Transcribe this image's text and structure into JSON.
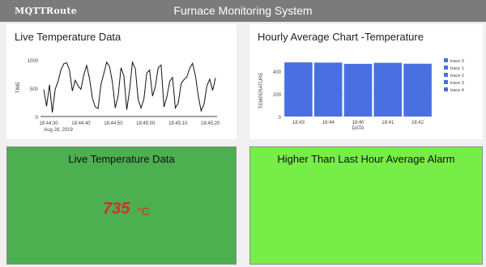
{
  "header": {
    "brand": "MQTTRoute",
    "title": "Furnace Monitoring System"
  },
  "live_chart": {
    "title": "Live Temperature Data",
    "chart_data": {
      "type": "line",
      "title": "",
      "xlabel": "",
      "ylabel": "TIME",
      "ylim": [
        0,
        1000
      ],
      "yticks": [
        "0",
        "500",
        "1000"
      ],
      "xticks": [
        "18:44:30",
        "18:44:40",
        "18:44:50",
        "18:45:00",
        "18:45:10",
        "18:45:20"
      ],
      "date_label": "Aug 28, 2019",
      "series": [
        {
          "color": "#111111",
          "values": [
            480,
            180,
            560,
            70,
            480,
            620,
            820,
            930,
            950,
            820,
            450,
            640,
            540,
            480,
            740,
            900,
            670,
            320,
            170,
            140,
            570,
            760,
            960,
            880,
            600,
            150,
            370,
            860,
            720,
            120,
            470,
            960,
            840,
            300,
            150,
            310,
            770,
            820,
            360,
            530,
            860,
            910,
            170,
            340,
            620,
            690,
            150,
            240,
            580,
            650,
            700,
            850,
            940,
            720,
            360,
            100,
            220,
            540,
            660,
            460,
            680
          ]
        }
      ]
    }
  },
  "hourly_chart": {
    "title": "Hourly Average Chart -Temperature",
    "chart_data": {
      "type": "bar",
      "title": "",
      "xlabel": "DATA",
      "ylabel": "TEMPERATURE",
      "ylim": [
        0,
        500
      ],
      "yticks": [
        "0",
        "200",
        "400"
      ],
      "categories": [
        "18:43",
        "18:44",
        "18:40",
        "18:41",
        "18:42"
      ],
      "values": [
        478,
        476,
        465,
        474,
        466
      ],
      "legend": [
        "trace 0",
        "trace 1",
        "trace 2",
        "trace 3",
        "trace 4"
      ],
      "legend_position": "right",
      "bar_color": "#4a6fe0"
    }
  },
  "live_panel": {
    "title": "Live Temperature Data",
    "value": "735",
    "unit": "°C",
    "bg": "#4caf50"
  },
  "alarm_panel": {
    "title": "Higher Than Last Hour Average Alarm",
    "bg": "#76ee47"
  }
}
